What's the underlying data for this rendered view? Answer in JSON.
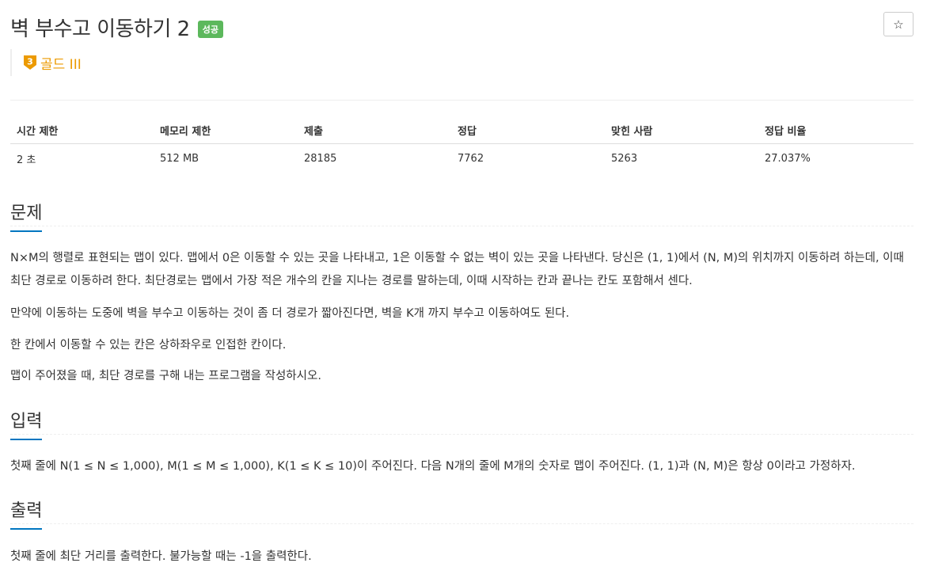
{
  "problem": {
    "title": "벽 부수고 이동하기 2",
    "result_badge": "성공",
    "star_icon": "star-outline-icon",
    "tier": {
      "level": "3",
      "label": "골드 III",
      "color": "#ec9a00"
    }
  },
  "info_table": {
    "headers": [
      "시간 제한",
      "메모리 제한",
      "제출",
      "정답",
      "맞힌 사람",
      "정답 비율"
    ],
    "values": [
      "2 초",
      "512 MB",
      "28185",
      "7762",
      "5263",
      "27.037%"
    ]
  },
  "sections": {
    "description": {
      "title": "문제",
      "paragraphs": [
        "N×M의 행렬로 표현되는 맵이 있다. 맵에서 0은 이동할 수 있는 곳을 나타내고, 1은 이동할 수 없는 벽이 있는 곳을 나타낸다. 당신은 (1, 1)에서 (N, M)의 위치까지 이동하려 하는데, 이때 최단 경로로 이동하려 한다. 최단경로는 맵에서 가장 적은 개수의 칸을 지나는 경로를 말하는데, 이때 시작하는 칸과 끝나는 칸도 포함해서 센다.",
        "만약에 이동하는 도중에 벽을 부수고 이동하는 것이 좀 더 경로가 짧아진다면, 벽을 K개 까지 부수고 이동하여도 된다.",
        "한 칸에서 이동할 수 있는 칸은 상하좌우로 인접한 칸이다.",
        "맵이 주어졌을 때, 최단 경로를 구해 내는 프로그램을 작성하시오."
      ]
    },
    "input": {
      "title": "입력",
      "paragraphs": [
        "첫째 줄에 N(1 ≤ N ≤ 1,000), M(1 ≤ M ≤ 1,000), K(1 ≤ K ≤ 10)이 주어진다. 다음 N개의 줄에 M개의 숫자로 맵이 주어진다. (1, 1)과 (N, M)은 항상 0이라고 가정하자."
      ]
    },
    "output": {
      "title": "출력",
      "paragraphs": [
        "첫째 줄에 최단 거리를 출력한다. 불가능할 때는 -1을 출력한다."
      ]
    }
  },
  "colors": {
    "badge_success": "#5cb85c",
    "section_underline": "#0076c0",
    "tier_gold": "#ec9a00"
  }
}
